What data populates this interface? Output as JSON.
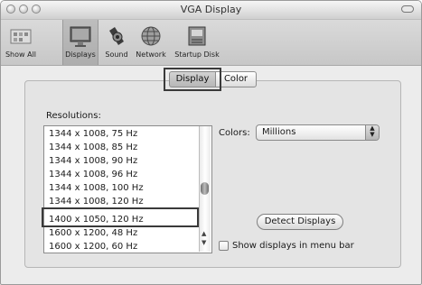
{
  "window": {
    "title": "VGA Display"
  },
  "toolbar": {
    "items": [
      {
        "label": "Show All",
        "icon": "show-all-icon"
      },
      {
        "label": "Displays",
        "icon": "displays-icon"
      },
      {
        "label": "Sound",
        "icon": "sound-icon"
      },
      {
        "label": "Network",
        "icon": "network-icon"
      },
      {
        "label": "Startup Disk",
        "icon": "startup-disk-icon"
      }
    ],
    "selected": "Displays"
  },
  "tabs": [
    {
      "label": "Display",
      "selected": true
    },
    {
      "label": "Color",
      "selected": false
    }
  ],
  "resolutions": {
    "label": "Resolutions:",
    "items": [
      "1344 x 1008, 75 Hz",
      "1344 x 1008, 85 Hz",
      "1344 x 1008, 90 Hz",
      "1344 x 1008, 96 Hz",
      "1344 x 1008, 100 Hz",
      "1344 x 1008, 120 Hz",
      "1400 x 1050, 120 Hz",
      "1600 x 1200, 48 Hz",
      "1600 x 1200, 60 Hz"
    ],
    "highlighted": "1400 x 1050, 120 Hz"
  },
  "colors": {
    "label": "Colors:",
    "value": "Millions"
  },
  "detect_button": "Detect Displays",
  "menu_bar_checkbox": {
    "label": "Show displays in menu bar",
    "checked": false
  }
}
